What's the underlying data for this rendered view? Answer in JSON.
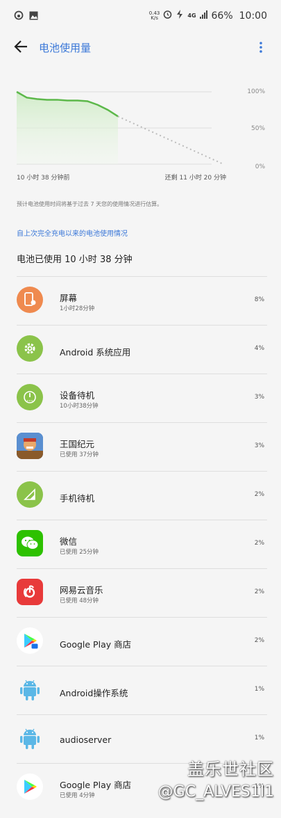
{
  "status_bar": {
    "net_speed_top": "0.43",
    "net_speed_bottom": "K/s",
    "network": "4G",
    "battery_percent": "66%",
    "time": "10:00"
  },
  "header": {
    "title": "电池使用量"
  },
  "chart": {
    "y_labels": [
      "100%",
      "50%",
      "0%"
    ],
    "x_label_left": "10 小时 38 分钟前",
    "x_label_right": "还剩 11 小时 20 分钟",
    "accent_color": "#5cb84a",
    "projection_color": "#bbbbbb"
  },
  "chart_data": {
    "type": "line",
    "y_unit": "%",
    "ylim": [
      0,
      100
    ],
    "history": {
      "values_percent": [
        100,
        92,
        90,
        89,
        89,
        88,
        88,
        87,
        82,
        75,
        66
      ]
    },
    "projection": {
      "values_percent": [
        66,
        0
      ]
    }
  },
  "estimate_note": "预计电池使用时间将基于过去 7 天您的使用情况进行估算。",
  "section_link": "自上次完全充电以来的电池使用情况",
  "usage_summary": "电池已使用 10 小时 38 分钟",
  "apps": [
    {
      "name": "屏幕",
      "sub": "1小时28分钟",
      "pct": "8%",
      "icon": "screen-icon",
      "color": "#ef8a4f"
    },
    {
      "name": "Android 系统应用",
      "sub": "",
      "pct": "4%",
      "icon": "gear-icon",
      "color": "#8bc34a"
    },
    {
      "name": "设备待机",
      "sub": "10小时38分钟",
      "pct": "3%",
      "icon": "power-icon",
      "color": "#8bc34a"
    },
    {
      "name": "王国纪元",
      "sub": "已使用 37分钟",
      "pct": "3%",
      "icon": "game-icon",
      "color": "#3a6fb5"
    },
    {
      "name": "手机待机",
      "sub": "",
      "pct": "2%",
      "icon": "signal-icon",
      "color": "#8bc34a"
    },
    {
      "name": "微信",
      "sub": "已使用 25分钟",
      "pct": "2%",
      "icon": "wechat-icon",
      "color": "#2dc100"
    },
    {
      "name": "网易云音乐",
      "sub": "已使用 48分钟",
      "pct": "2%",
      "icon": "netease-music-icon",
      "color": "#e83a3a"
    },
    {
      "name": "Google Play 商店",
      "sub": "",
      "pct": "2%",
      "icon": "google-play-icon",
      "color": "#ffffff"
    },
    {
      "name": "Android操作系统",
      "sub": "",
      "pct": "1%",
      "icon": "android-icon",
      "color": "#5bb7e6"
    },
    {
      "name": "audioserver",
      "sub": "",
      "pct": "1%",
      "icon": "android-icon",
      "color": "#5bb7e6"
    },
    {
      "name": "Google Play 商店",
      "sub": "已使用 4分钟",
      "pct": "1%",
      "icon": "google-play-icon",
      "color": "#ffffff"
    }
  ],
  "watermark": {
    "line1": "盖乐世社区",
    "line2": "@GC_ALVES1l1"
  }
}
